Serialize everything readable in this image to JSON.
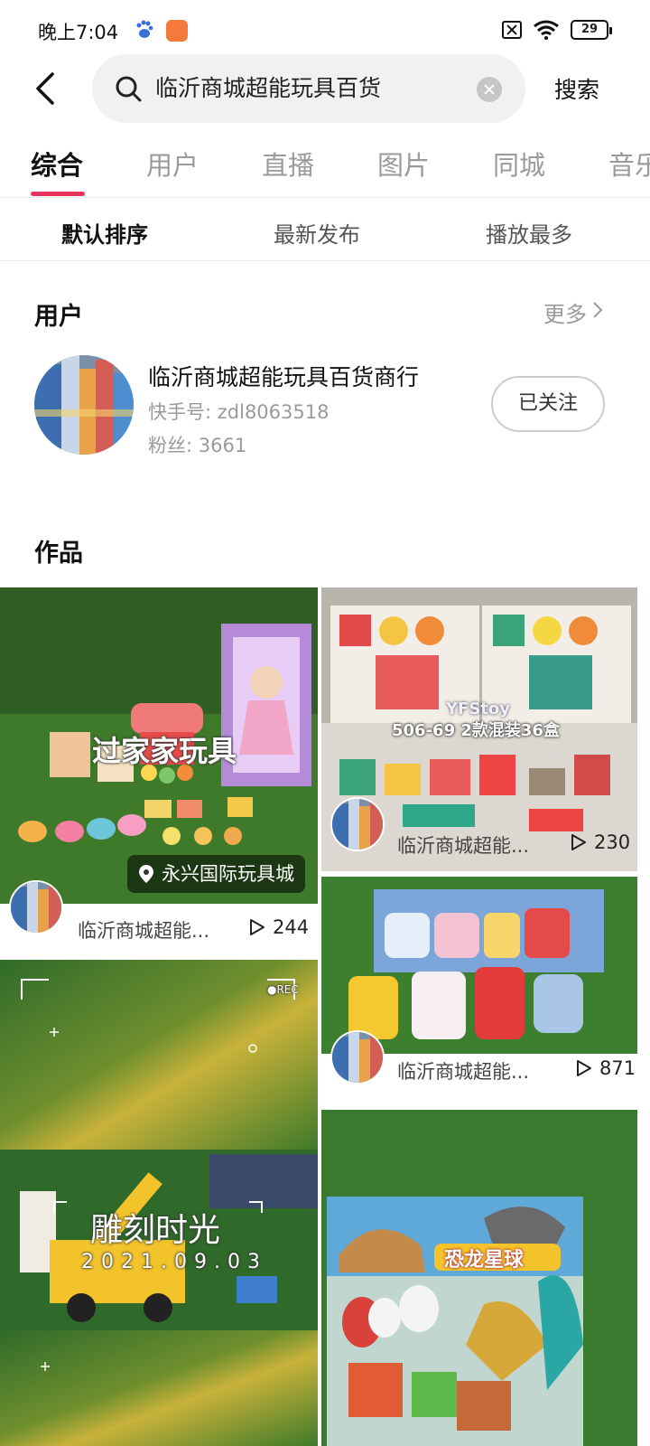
{
  "status_bar": {
    "time": "晚上7:04",
    "battery": "29"
  },
  "search": {
    "query": "临沂商城超能玩具百货",
    "button": "搜索"
  },
  "tabs": [
    "综合",
    "用户",
    "直播",
    "图片",
    "同城",
    "音乐"
  ],
  "sort_options": [
    "默认排序",
    "最新发布",
    "播放最多"
  ],
  "user_section": {
    "title": "用户",
    "more": "更多",
    "user": {
      "name": "临沂商城超能玩具百货商行",
      "id_line": "快手号: zdl8063518",
      "fans_line": "粉丝: 3661",
      "follow_state": "已关注"
    }
  },
  "works_section": {
    "title": "作品",
    "items": [
      {
        "overlay_title": "过家家玩具",
        "location": "永兴国际玩具城",
        "author": "临沂商城超能...",
        "plays": "244"
      },
      {
        "overlay_brand": "YFStoy",
        "overlay_caption": "506-69  2款混装36盒",
        "author": "临沂商城超能...",
        "plays": "230"
      },
      {
        "author": "临沂商城超能...",
        "plays": "871"
      },
      {
        "overlay_title": "雕刻时光",
        "overlay_date": "2021.09.03",
        "rec": "●REC"
      },
      {
        "overlay_title": "恐龙星球"
      }
    ]
  },
  "colors": {
    "accent": "#e8335d",
    "muted": "#9a9a9a"
  }
}
